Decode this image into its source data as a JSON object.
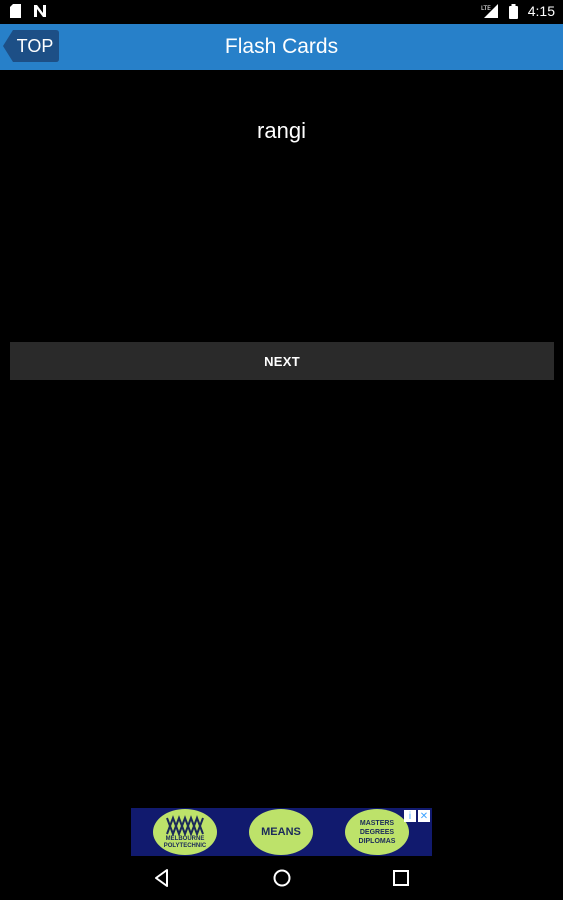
{
  "status_bar": {
    "time": "4:15",
    "icons": [
      "sim-card-icon",
      "notification-n-icon",
      "lte-signal-icon",
      "battery-icon"
    ]
  },
  "app_bar": {
    "back_label": "TOP",
    "title": "Flash Cards",
    "color": "#2780c9"
  },
  "card": {
    "word": "rangi"
  },
  "actions": {
    "next_label": "NEXT"
  },
  "ad": {
    "badge1": [
      "MELBOURNE",
      "POLYTECHNIC"
    ],
    "badge2": "MEANS",
    "badge3": [
      "MASTERS",
      "DEGREES",
      "DIPLOMAS"
    ]
  },
  "nav_bar": {
    "buttons": [
      "back-icon",
      "home-icon",
      "recent-apps-icon"
    ]
  }
}
